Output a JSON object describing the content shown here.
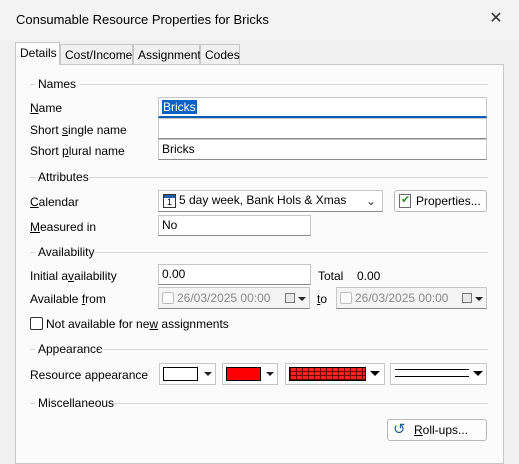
{
  "window": {
    "title": "Consumable Resource Properties for Bricks",
    "close_glyph": "✕"
  },
  "tabs": [
    {
      "label": "Details",
      "active": true
    },
    {
      "label": "Cost/Income",
      "active": false
    },
    {
      "label": "Assignment",
      "active": false
    },
    {
      "label": "Codes",
      "active": false
    }
  ],
  "names": {
    "section": "Names",
    "name_label_u": "N",
    "name_label_rest": "ame",
    "name_value": "Bricks",
    "short_single_pre": "Short ",
    "short_single_u": "s",
    "short_single_post": "ingle name",
    "short_single_value": "",
    "short_plural_pre": "Short ",
    "short_plural_u": "p",
    "short_plural_post": "lural name",
    "short_plural_value": "Bricks"
  },
  "attributes": {
    "section": "Attributes",
    "calendar_u": "C",
    "calendar_rest": "alendar",
    "calendar_value": "5 day week, Bank Hols & Xmas",
    "properties_button": "Properties...",
    "measured_u": "M",
    "measured_rest": "easured in",
    "measured_value": "No"
  },
  "availability": {
    "section": "Availability",
    "initial_pre": "Initial a",
    "initial_u": "v",
    "initial_post": "ailability",
    "initial_value": "0.00",
    "total_label": "Total",
    "total_value": "0.00",
    "from_pre": "Available ",
    "from_u": "f",
    "from_post": "rom",
    "from_value": "26/03/2025 00:00",
    "to_u": "t",
    "to_post": "o",
    "to_value": "26/03/2025 00:00",
    "not_available_pre": "Not available for ne",
    "not_available_u": "w",
    "not_available_post": " assignments",
    "not_available_checked": false
  },
  "appearance": {
    "section": "Appearance",
    "resource_appearance_label": "Resource appearance",
    "colors": {
      "color1": "#ffffff",
      "color2": "#ff0000",
      "pattern": "#ff0000"
    }
  },
  "misc": {
    "section": "Miscellaneous",
    "rollups_u": "R",
    "rollups_post": "oll-ups...",
    "rollups_icon": "rollup-icon"
  }
}
